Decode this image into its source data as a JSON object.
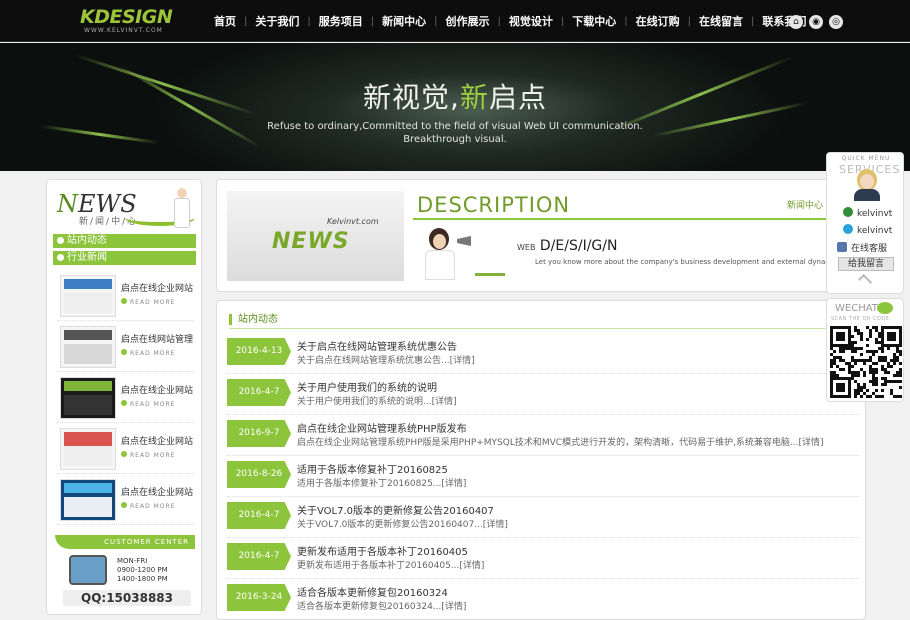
{
  "header": {
    "logo_text": "KDESIGN",
    "logo_url_text": "WWW.KELVINVT.COM",
    "nav": [
      "首页",
      "关于我们",
      "服务项目",
      "新闻中心",
      "创作展示",
      "视觉设计",
      "下载中心",
      "在线订购",
      "在线留言",
      "联系我们"
    ],
    "nav_separator": "|",
    "right_icons": [
      "home-icon",
      "sitemap-icon",
      "rss-icon"
    ]
  },
  "banner": {
    "title_pre": "新视觉,",
    "title_highlight": "新",
    "title_post": "启点",
    "subtitle_line1": "Refuse to ordinary,Committed to the field of visual Web UI communication.",
    "subtitle_line2": "Breakthrough visual."
  },
  "sidebar": {
    "news_big_first": "N",
    "news_big_rest": "EWS",
    "news_small": "新/闻/中/心",
    "categories": [
      "站内动态",
      "行业新闻"
    ],
    "products": [
      {
        "title": "启点在线企业网站",
        "more": "READ MORE"
      },
      {
        "title": "启点在线网站管理",
        "more": "READ MORE"
      },
      {
        "title": "启点在线企业网站",
        "more": "READ MORE"
      },
      {
        "title": "启点在线企业网站",
        "more": "READ MORE"
      },
      {
        "title": "启点在线企业网站",
        "more": "READ MORE"
      }
    ],
    "customer_center": "CUSTOMER CENTER",
    "hours": "MON-FRI\n0900-1200 PM\n1400-1800 PM",
    "qq": "QQ:15038883"
  },
  "description": {
    "banner_site": "Kelvinvt.com",
    "banner_news": "NEWS",
    "heading": "DESCRIPTION",
    "breadcrumb": "新闻中心",
    "web_prefix": "WEB",
    "web_design": "D/E/S/I/G/N",
    "tagline": "Let you know more about the company's business development and external dynamics"
  },
  "news_list": {
    "title": "站内动态",
    "items": [
      {
        "date": "2016-4-13",
        "title": "关于启点在线网站管理系统优惠公告",
        "desc": "关于启点在线网站管理系统优惠公告...[详情]"
      },
      {
        "date": "2016-4-7",
        "title": "关于用户使用我们的系统的说明",
        "desc": "关于用户使用我们的系统的说明...[详情]"
      },
      {
        "date": "2016-9-7",
        "title": "启点在线企业网站管理系统PHP版发布",
        "desc": "启点在线企业网站管理系统PHP版是采用PHP+MYSQL技术和MVC模式进行开发的，架构清晰，代码易于维护,系统兼容电脑...[详情]"
      },
      {
        "date": "2016-8-26",
        "title": "适用于各版本修复补丁20160825",
        "desc": "适用于各版本修复补丁20160825...[详情]"
      },
      {
        "date": "2016-4-7",
        "title": "关于VOL7.0版本的更新修复公告20160407",
        "desc": "关于VOL7.0版本的更新修复公告20160407...[详情]"
      },
      {
        "date": "2016-4-7",
        "title": "更新发布适用于各版本补丁20160405",
        "desc": "更新发布适用于各版本补丁20160405...[详情]"
      },
      {
        "date": "2016-3-24",
        "title": "适合各版本更新修复包20160324",
        "desc": "适合各版本更新修复包20160324...[详情]"
      }
    ]
  },
  "service": {
    "quick_menu": "QUICK MENU",
    "services": "SERVICES",
    "contacts": [
      {
        "label": "kelvinvt",
        "icon": "wangwang-icon"
      },
      {
        "label": "kelvinvt",
        "icon": "skype-icon"
      },
      {
        "label": "在线客服",
        "icon": "chat-icon"
      }
    ],
    "leave_message": "给我留言",
    "wechat": "WECHAT",
    "wechat_sub": "SCAN THE QR CODE"
  },
  "colors": {
    "accent": "#8cc43b",
    "accent_dark": "#5e8f1e",
    "header_bg": "#0d0d0d"
  }
}
